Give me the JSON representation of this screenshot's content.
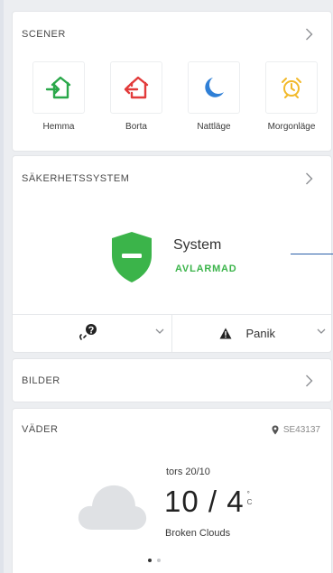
{
  "scener": {
    "title": "SCENER",
    "items": [
      {
        "label": "Hemma",
        "icon": "home-enter-icon",
        "color": "#2aa84a"
      },
      {
        "label": "Borta",
        "icon": "home-leave-icon",
        "color": "#e23a3a"
      },
      {
        "label": "Nattläge",
        "icon": "moon-icon",
        "color": "#2f7fd6"
      },
      {
        "label": "Morgonläge",
        "icon": "alarm-clock-icon",
        "color": "#f2b92a"
      }
    ]
  },
  "security": {
    "title": "SÄKERHETSSYSTEM",
    "system_name": "System",
    "status": "AVLARMAD",
    "status_color": "#3bb44a",
    "panic_label": "Panik"
  },
  "bilder": {
    "title": "BILDER"
  },
  "vader": {
    "title": "VÄDER",
    "location": "SE43137",
    "date": "tors 20/10",
    "temp": "10 / 4",
    "unit_top": "°",
    "unit_bottom": "C",
    "description": "Broken Clouds"
  }
}
